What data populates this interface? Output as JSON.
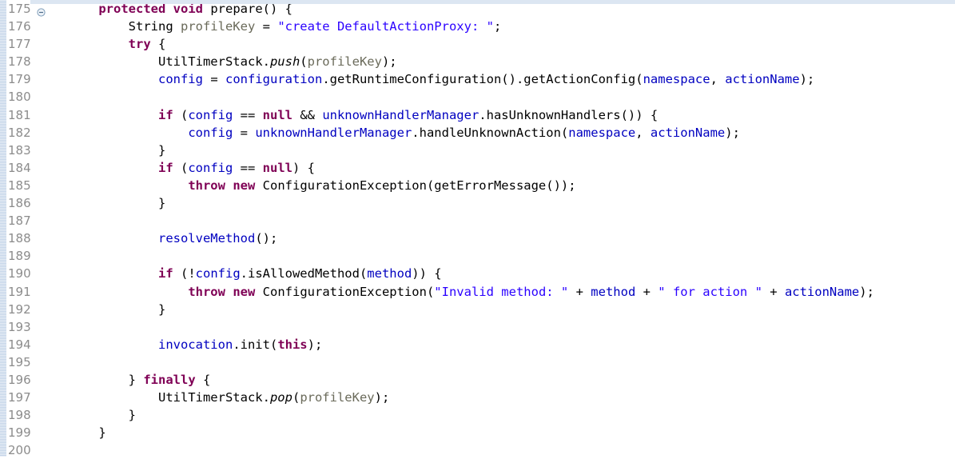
{
  "editor": {
    "language": "java",
    "first_line": 175,
    "last_line": 200,
    "fold_marker_line": 175,
    "colors": {
      "background": "#ffffff",
      "keyword": "#7f0055",
      "field": "#0000c0",
      "string": "#2a00ff",
      "local_variable": "#6a6a5a",
      "plain_text": "#000000",
      "line_number": "#8c8c8c",
      "selection_strip": "#dce6f2",
      "marker_bar": "#c3d4e8"
    }
  },
  "gutter": {
    "line_numbers": [
      "175",
      "176",
      "177",
      "178",
      "179",
      "180",
      "181",
      "182",
      "183",
      "184",
      "185",
      "186",
      "187",
      "188",
      "189",
      "190",
      "191",
      "192",
      "193",
      "194",
      "195",
      "196",
      "197",
      "198",
      "199",
      "200"
    ],
    "fold_icon_name": "fold-collapse-icon"
  },
  "code": {
    "plain_lines": [
      "    protected void prepare() {",
      "        String profileKey = \"create DefaultActionProxy: \";",
      "        try {",
      "            UtilTimerStack.push(profileKey);",
      "            config = configuration.getRuntimeConfiguration().getActionConfig(namespace, actionName);",
      "",
      "            if (config == null && unknownHandlerManager.hasUnknownHandlers()) {",
      "                config = unknownHandlerManager.handleUnknownAction(namespace, actionName);",
      "            }",
      "            if (config == null) {",
      "                throw new ConfigurationException(getErrorMessage());",
      "            }",
      "",
      "            resolveMethod();",
      "",
      "            if (!config.isAllowedMethod(method)) {",
      "                throw new ConfigurationException(\"Invalid method: \" + method + \" for action \" + actionName);",
      "            }",
      "",
      "            invocation.init(this);",
      "",
      "        } finally {",
      "            UtilTimerStack.pop(profileKey);",
      "        }",
      "    }",
      ""
    ],
    "tokenized_lines": [
      [
        {
          "t": "    ",
          "c": "plain"
        },
        {
          "t": "protected",
          "c": "kw"
        },
        {
          "t": " ",
          "c": "plain"
        },
        {
          "t": "void",
          "c": "kw"
        },
        {
          "t": " prepare() {",
          "c": "plain"
        }
      ],
      [
        {
          "t": "        String ",
          "c": "plain"
        },
        {
          "t": "profileKey",
          "c": "local"
        },
        {
          "t": " = ",
          "c": "plain"
        },
        {
          "t": "\"create DefaultActionProxy: \"",
          "c": "string"
        },
        {
          "t": ";",
          "c": "plain"
        }
      ],
      [
        {
          "t": "        ",
          "c": "plain"
        },
        {
          "t": "try",
          "c": "kw"
        },
        {
          "t": " {",
          "c": "plain"
        }
      ],
      [
        {
          "t": "            UtilTimerStack.",
          "c": "plain"
        },
        {
          "t": "push",
          "c": "static"
        },
        {
          "t": "(",
          "c": "plain"
        },
        {
          "t": "profileKey",
          "c": "local"
        },
        {
          "t": ");",
          "c": "plain"
        }
      ],
      [
        {
          "t": "            ",
          "c": "plain"
        },
        {
          "t": "config",
          "c": "field"
        },
        {
          "t": " = ",
          "c": "plain"
        },
        {
          "t": "configuration",
          "c": "field"
        },
        {
          "t": ".getRuntimeConfiguration().getActionConfig(",
          "c": "plain"
        },
        {
          "t": "namespace",
          "c": "field"
        },
        {
          "t": ", ",
          "c": "plain"
        },
        {
          "t": "actionName",
          "c": "field"
        },
        {
          "t": ");",
          "c": "plain"
        }
      ],
      [],
      [
        {
          "t": "            ",
          "c": "plain"
        },
        {
          "t": "if",
          "c": "kw"
        },
        {
          "t": " (",
          "c": "plain"
        },
        {
          "t": "config",
          "c": "field"
        },
        {
          "t": " == ",
          "c": "plain"
        },
        {
          "t": "null",
          "c": "kw"
        },
        {
          "t": " && ",
          "c": "plain"
        },
        {
          "t": "unknownHandlerManager",
          "c": "field"
        },
        {
          "t": ".hasUnknownHandlers()) {",
          "c": "plain"
        }
      ],
      [
        {
          "t": "                ",
          "c": "plain"
        },
        {
          "t": "config",
          "c": "field"
        },
        {
          "t": " = ",
          "c": "plain"
        },
        {
          "t": "unknownHandlerManager",
          "c": "field"
        },
        {
          "t": ".handleUnknownAction(",
          "c": "plain"
        },
        {
          "t": "namespace",
          "c": "field"
        },
        {
          "t": ", ",
          "c": "plain"
        },
        {
          "t": "actionName",
          "c": "field"
        },
        {
          "t": ");",
          "c": "plain"
        }
      ],
      [
        {
          "t": "            }",
          "c": "plain"
        }
      ],
      [
        {
          "t": "            ",
          "c": "plain"
        },
        {
          "t": "if",
          "c": "kw"
        },
        {
          "t": " (",
          "c": "plain"
        },
        {
          "t": "config",
          "c": "field"
        },
        {
          "t": " == ",
          "c": "plain"
        },
        {
          "t": "null",
          "c": "kw"
        },
        {
          "t": ") {",
          "c": "plain"
        }
      ],
      [
        {
          "t": "                ",
          "c": "plain"
        },
        {
          "t": "throw",
          "c": "kw"
        },
        {
          "t": " ",
          "c": "plain"
        },
        {
          "t": "new",
          "c": "kw"
        },
        {
          "t": " ConfigurationException(getErrorMessage());",
          "c": "plain"
        }
      ],
      [
        {
          "t": "            }",
          "c": "plain"
        }
      ],
      [],
      [
        {
          "t": "            ",
          "c": "plain"
        },
        {
          "t": "resolveMethod",
          "c": "field"
        },
        {
          "t": "();",
          "c": "plain"
        }
      ],
      [],
      [
        {
          "t": "            ",
          "c": "plain"
        },
        {
          "t": "if",
          "c": "kw"
        },
        {
          "t": " (!",
          "c": "plain"
        },
        {
          "t": "config",
          "c": "field"
        },
        {
          "t": ".isAllowedMethod(",
          "c": "plain"
        },
        {
          "t": "method",
          "c": "field"
        },
        {
          "t": ")) {",
          "c": "plain"
        }
      ],
      [
        {
          "t": "                ",
          "c": "plain"
        },
        {
          "t": "throw",
          "c": "kw"
        },
        {
          "t": " ",
          "c": "plain"
        },
        {
          "t": "new",
          "c": "kw"
        },
        {
          "t": " ConfigurationException(",
          "c": "plain"
        },
        {
          "t": "\"Invalid method: \"",
          "c": "string"
        },
        {
          "t": " + ",
          "c": "plain"
        },
        {
          "t": "method",
          "c": "field"
        },
        {
          "t": " + ",
          "c": "plain"
        },
        {
          "t": "\" for action \"",
          "c": "string"
        },
        {
          "t": " + ",
          "c": "plain"
        },
        {
          "t": "actionName",
          "c": "field"
        },
        {
          "t": ");",
          "c": "plain"
        }
      ],
      [
        {
          "t": "            }",
          "c": "plain"
        }
      ],
      [],
      [
        {
          "t": "            ",
          "c": "plain"
        },
        {
          "t": "invocation",
          "c": "field"
        },
        {
          "t": ".init(",
          "c": "plain"
        },
        {
          "t": "this",
          "c": "kw"
        },
        {
          "t": ");",
          "c": "plain"
        }
      ],
      [],
      [
        {
          "t": "        } ",
          "c": "plain"
        },
        {
          "t": "finally",
          "c": "kw"
        },
        {
          "t": " {",
          "c": "plain"
        }
      ],
      [
        {
          "t": "            UtilTimerStack.",
          "c": "plain"
        },
        {
          "t": "pop",
          "c": "static"
        },
        {
          "t": "(",
          "c": "plain"
        },
        {
          "t": "profileKey",
          "c": "local"
        },
        {
          "t": ");",
          "c": "plain"
        }
      ],
      [
        {
          "t": "        }",
          "c": "plain"
        }
      ],
      [
        {
          "t": "    }",
          "c": "plain"
        }
      ],
      []
    ]
  }
}
